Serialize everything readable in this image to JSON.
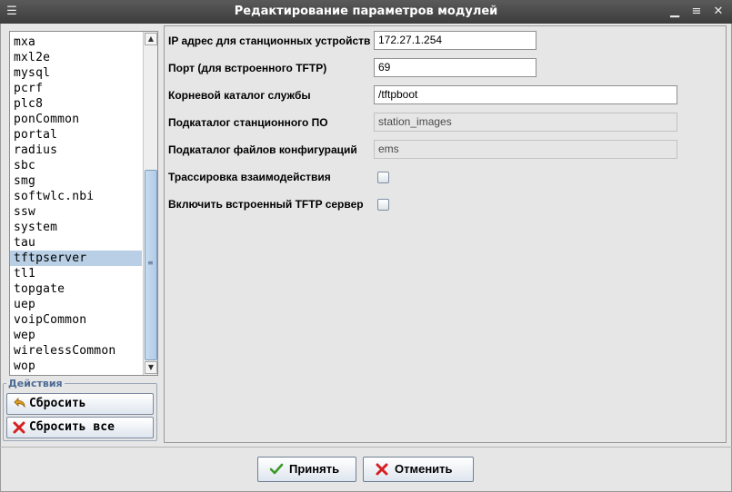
{
  "window": {
    "title": "Редактирование параметров модулей"
  },
  "module_list": {
    "items": [
      "mxa",
      "mxl2e",
      "mysql",
      "pcrf",
      "plc8",
      "ponCommon",
      "portal",
      "radius",
      "sbc",
      "smg",
      "softwlc.nbi",
      "ssw",
      "system",
      "tau",
      "tftpserver",
      "tl1",
      "topgate",
      "uep",
      "voipCommon",
      "wep",
      "wirelessCommon",
      "wop"
    ],
    "selected": "tftpserver"
  },
  "actions": {
    "legend": "Действия",
    "reset_label": "Сбросить",
    "reset_all_label": "Сбросить все"
  },
  "form": {
    "ip_label": "IP адрес для станционных устройств",
    "ip_value": "172.27.1.254",
    "port_label": "Порт (для встроенного TFTP)",
    "port_value": "69",
    "root_label": "Корневой каталог службы",
    "root_value": "/tftpboot",
    "station_sub_label": "Подкаталог станционного ПО",
    "station_sub_value": "station_images",
    "config_sub_label": "Подкаталог файлов конфигураций",
    "config_sub_value": "ems",
    "trace_label": "Трассировка взаимодействия",
    "trace_checked": false,
    "tftp_enable_label": "Включить встроенный TFTP сервер",
    "tftp_enable_checked": false
  },
  "buttons": {
    "accept_label": "Принять",
    "cancel_label": "Отменить"
  },
  "colors": {
    "title_bar": "#4a4a4a",
    "selection": "#b8cfe5",
    "accept_icon": "#3a9a2a",
    "cancel_icon": "#d62020"
  },
  "icons": {
    "menu": "window-menu-icon",
    "minimize": "minimize-icon",
    "maximize": "maximize-icon",
    "close": "close-icon",
    "reset": "undo-arrow-icon",
    "reset_all": "red-x-icon",
    "accept": "checkmark-icon",
    "cancel": "red-x-icon"
  }
}
